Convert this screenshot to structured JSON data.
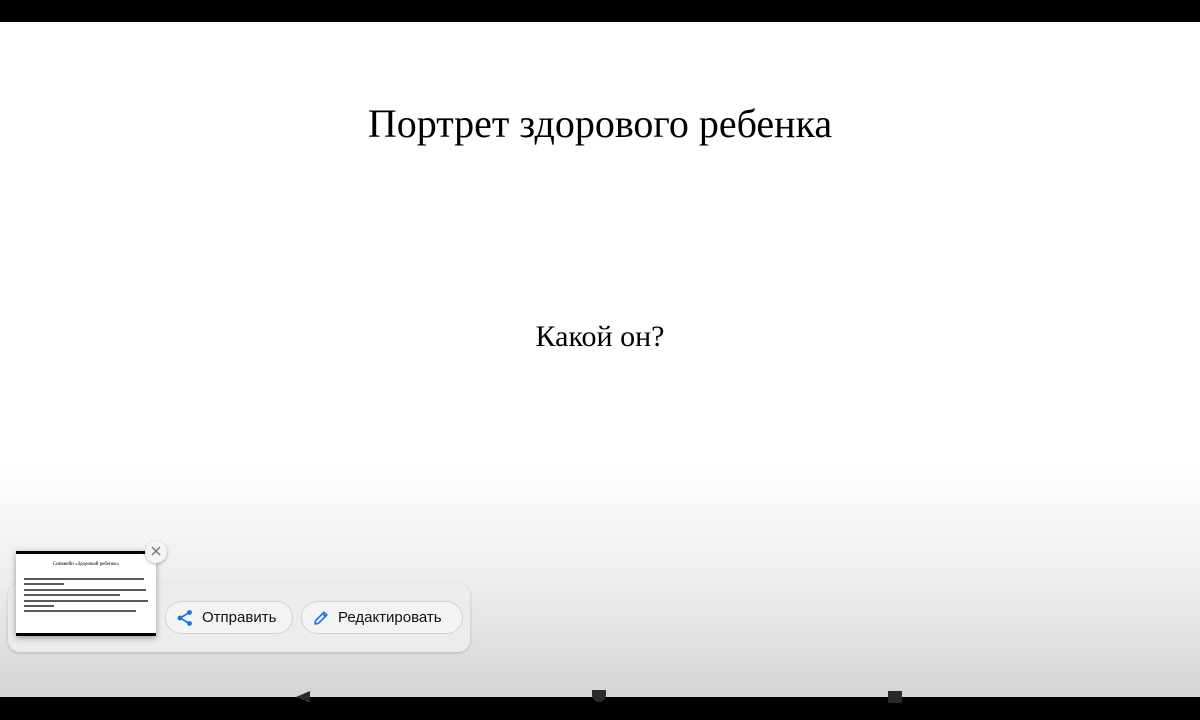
{
  "slide": {
    "title": "Портрет здорового ребенка",
    "subtitle": "Какой он?"
  },
  "screenshot_toolbar": {
    "share_label": "Отправить",
    "edit_label": "Редактировать",
    "thumbnail_title": "Синквейн «Здоровый ребенок»",
    "close_icon": "close-icon",
    "share_icon": "share-icon",
    "edit_icon": "pencil-icon"
  },
  "navigation": {
    "back_icon": "back-triangle-icon",
    "home_icon": "home-circle-icon",
    "recents_icon": "recents-square-icon"
  },
  "colors": {
    "accent": "#1a73e8"
  }
}
